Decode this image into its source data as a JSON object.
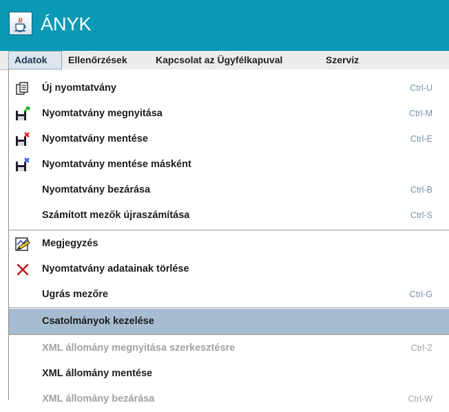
{
  "window": {
    "title": "ÁNYK",
    "icon": "java-cup-icon"
  },
  "menubar": [
    {
      "label": "Adatok",
      "active": true
    },
    {
      "label": "Ellenőrzések",
      "active": false
    },
    {
      "label": "Kapcsolat az Ügyfélkapuval",
      "active": false
    },
    {
      "label": "Szerviz",
      "active": false
    }
  ],
  "dropdown": {
    "items": [
      {
        "label": "Új nyomtatvány",
        "shortcut": "Ctrl-U",
        "icon": "new-form-icon",
        "enabled": true
      },
      {
        "label": "Nyomtatvány megnyitása",
        "shortcut": "Ctrl-M",
        "icon": "open-form-icon",
        "enabled": true
      },
      {
        "label": "Nyomtatvány mentése",
        "shortcut": "Ctrl-E",
        "icon": "save-form-icon",
        "enabled": true
      },
      {
        "label": "Nyomtatvány mentése másként",
        "shortcut": "",
        "icon": "save-as-icon",
        "enabled": true
      },
      {
        "label": "Nyomtatvány bezárása",
        "shortcut": "Ctrl-B",
        "icon": "",
        "enabled": true
      },
      {
        "label": "Számított mezők újraszámítása",
        "shortcut": "Ctrl-S",
        "icon": "",
        "enabled": true
      },
      {
        "label": "Megjegyzés",
        "shortcut": "",
        "icon": "note-icon",
        "enabled": true
      },
      {
        "label": "Nyomtatvány adatainak törlése",
        "shortcut": "",
        "icon": "delete-x-icon",
        "enabled": true
      },
      {
        "label": "Ugrás mezőre",
        "shortcut": "Ctrl-G",
        "icon": "",
        "enabled": true
      },
      {
        "label": "Csatolmányok kezelése",
        "shortcut": "",
        "icon": "",
        "enabled": true,
        "selected": true
      },
      {
        "label": "XML állomány megnyitása szerkesztésre",
        "shortcut": "Ctrl-Z",
        "icon": "",
        "enabled": false
      },
      {
        "label": "XML állomány mentése",
        "shortcut": "",
        "icon": "",
        "enabled": true
      },
      {
        "label": "XML állomány bezárása",
        "shortcut": "Ctrl-W",
        "icon": "",
        "enabled": false
      }
    ]
  },
  "colors": {
    "titlebar": "#0c99b6",
    "selection": "#a6bcd1",
    "shortcut_text": "#7591ad",
    "disabled_text": "#a2a2a2"
  }
}
